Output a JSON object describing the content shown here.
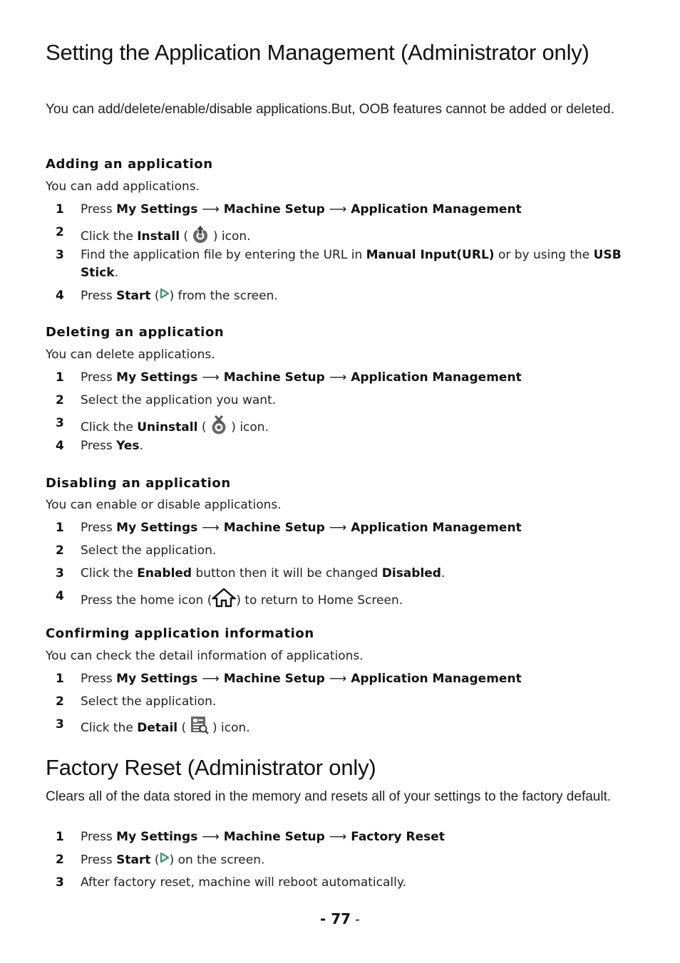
{
  "section1": {
    "title": "Setting the Application Management (Administrator only)",
    "intro": "You can add/delete/enable/disable applications.But, OOB features cannot be added or deleted.",
    "adding": {
      "heading": "Adding an application",
      "subtitle": "You can add applications.",
      "steps": [
        {
          "num": "1",
          "pre": "Press ",
          "path": [
            "My Settings",
            "Machine Setup",
            "Application Management"
          ]
        },
        {
          "num": "2",
          "pre": "Click the ",
          "bold": "Install",
          "open": " (",
          "icon": "install-icon",
          "close": " ) icon."
        },
        {
          "num": "3",
          "pre": "Find the application file by entering the URL in ",
          "bold1": "Manual Input(URL)",
          "mid": " or by using the ",
          "bold2": "USB Stick",
          "post": "."
        },
        {
          "num": "4",
          "pre": "Press ",
          "bold": "Start",
          "open": " (",
          "icon": "start-play-icon",
          "close": ") from the screen."
        }
      ]
    },
    "deleting": {
      "heading": "Deleting an application",
      "subtitle": "You can delete applications.",
      "steps": [
        {
          "num": "1",
          "pre": "Press ",
          "path": [
            "My Settings",
            "Machine Setup",
            "Application Management"
          ]
        },
        {
          "num": "2",
          "text": "Select the application you want."
        },
        {
          "num": "3",
          "pre": "Click the ",
          "bold": "Uninstall",
          "open": " (",
          "icon": "uninstall-icon",
          "close": " ) icon."
        },
        {
          "num": "4",
          "pre": "Press ",
          "bold": "Yes",
          "post": "."
        }
      ]
    },
    "disabling": {
      "heading": "Disabling an application",
      "subtitle": "You can enable or disable applications.",
      "steps": [
        {
          "num": "1",
          "pre": "Press ",
          "path": [
            "My Settings",
            "Machine Setup",
            "Application Management"
          ]
        },
        {
          "num": "2",
          "text": "Select the application."
        },
        {
          "num": "3",
          "pre": "Click the ",
          "bold1": "Enabled",
          "mid": " button then it will be changed ",
          "bold2": "Disabled",
          "post": "."
        },
        {
          "num": "4",
          "pre": "Press the home icon (",
          "icon": "home-icon",
          "close": ") to return to Home Screen."
        }
      ]
    },
    "confirming": {
      "heading": "Confirming application information",
      "subtitle": "You can check the detail information of applications.",
      "steps": [
        {
          "num": "1",
          "pre": "Press ",
          "path": [
            "My Settings",
            "Machine Setup",
            "Application Management"
          ]
        },
        {
          "num": "2",
          "text": "Select the application."
        },
        {
          "num": "3",
          "pre": "Click the ",
          "bold": "Detail",
          "open": " (",
          "icon": "detail-icon",
          "close": " ) icon."
        }
      ]
    }
  },
  "section2": {
    "title": "Factory Reset (Administrator only)",
    "intro": "Clears all of the data stored in the memory and resets all of your settings to the factory default.",
    "steps": [
      {
        "num": "1",
        "pre": "Press ",
        "path": [
          "My Settings",
          "Machine Setup",
          "Factory Reset"
        ]
      },
      {
        "num": "2",
        "pre": "Press ",
        "bold": "Start",
        "open": " (",
        "icon": "start-play-icon",
        "close": ") on the screen."
      },
      {
        "num": "3",
        "text": "After factory reset, machine will reboot automatically."
      }
    ]
  },
  "arrow": "⟶",
  "footer": {
    "dash_left": "- ",
    "page_number": "77",
    "dash_right": " -"
  },
  "colors": {
    "start_icon": "#2e9e5b",
    "icon_gray": "#555555"
  }
}
